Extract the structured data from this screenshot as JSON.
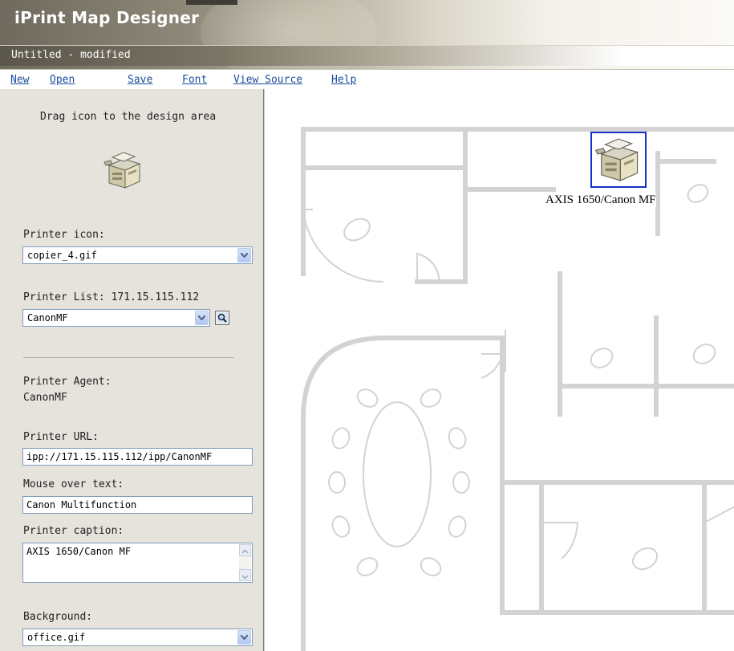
{
  "app": {
    "title": "iPrint Map Designer",
    "document_title": "Untitled - modified"
  },
  "menu": [
    {
      "label": "New"
    },
    {
      "label": "Open"
    },
    {
      "label": "Save"
    },
    {
      "label": "Font"
    },
    {
      "label": "View Source"
    },
    {
      "label": "Help"
    }
  ],
  "sidebar": {
    "drag_hint": "Drag icon to the design area",
    "printer_icon_label": "Printer icon:",
    "printer_icon_value": "copier_4.gif",
    "printer_list_label": "Printer List: 171.15.115.112",
    "printer_list_value": "CanonMF",
    "printer_agent_label": "Printer Agent:",
    "printer_agent_value": "CanonMF",
    "printer_url_label": "Printer URL:",
    "printer_url_value": "ipp://171.15.115.112/ipp/CanonMF",
    "mouse_over_label": "Mouse over text:",
    "mouse_over_value": "Canon Multifunction",
    "caption_label": "Printer caption:",
    "caption_value": "AXIS 1650/Canon MF",
    "background_label": "Background:",
    "background_value": "office.gif"
  },
  "canvas": {
    "placed_printer_caption": "AXIS 1650/Canon MF",
    "placed_printer_icon": "copier-icon"
  },
  "colors": {
    "link": "#1c4e9b",
    "wall": "#d3d3d3",
    "selection": "#1430c8"
  }
}
